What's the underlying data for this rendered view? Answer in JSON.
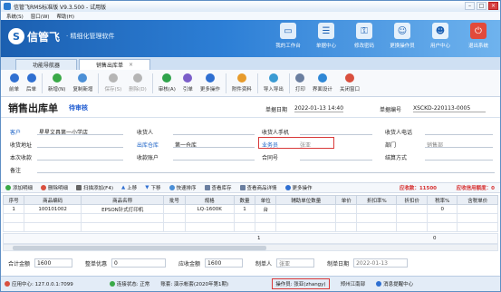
{
  "window": {
    "title": "信管飞RMS标准版 V9.3.500 - 试用版"
  },
  "menu": [
    "系统(S)",
    "窗口(W)",
    "帮助(H)"
  ],
  "banner": {
    "brand": "信管飞",
    "slogan": "· 精细化管理软件"
  },
  "top_tools": [
    {
      "label": "我的工作台",
      "icon": "monitor-icon"
    },
    {
      "label": "单据中心",
      "icon": "document-center-icon"
    },
    {
      "label": "修改密码",
      "icon": "key-icon"
    },
    {
      "label": "更换操作员",
      "icon": "users-icon"
    },
    {
      "label": "用户中心",
      "icon": "user-icon"
    },
    {
      "label": "退出系统",
      "icon": "power-icon"
    }
  ],
  "tabs": [
    {
      "label": "功能导航器"
    },
    {
      "label": "销售出库单",
      "close": "×"
    }
  ],
  "toolbar": [
    {
      "label": "前单",
      "color": "#2f6fd1",
      "disabled": false
    },
    {
      "label": "后单",
      "color": "#2f6fd1",
      "disabled": false
    },
    {
      "label": "新增(N)",
      "color": "#3aa948",
      "disabled": false
    },
    {
      "label": "复制新增",
      "color": "#4b8fd6",
      "disabled": false
    },
    {
      "label": "保存(S)",
      "color": "#b5b5b5",
      "disabled": true
    },
    {
      "label": "删除(D)",
      "color": "#b5b5b5",
      "disabled": true
    },
    {
      "label": "审核(A)",
      "color": "#2fa34c",
      "disabled": false
    },
    {
      "label": "引单",
      "color": "#7b5ec9",
      "disabled": false
    },
    {
      "label": "更多操作",
      "color": "#2f6fd1",
      "disabled": false
    },
    {
      "label": "附件资料",
      "color": "#e79b2c",
      "disabled": false
    },
    {
      "label": "导入导出",
      "color": "#3a9bd3",
      "disabled": false
    },
    {
      "label": "打印",
      "color": "#6b7fa0",
      "disabled": false
    },
    {
      "label": "界面设计",
      "color": "#2f88d6",
      "disabled": false
    },
    {
      "label": "关闭窗口",
      "color": "#d9503f",
      "disabled": false
    }
  ],
  "form": {
    "title": "销售出库单",
    "status": "待审核",
    "date_label": "单据日期",
    "date_value": "2022-01-13 14:40",
    "no_label": "单据编号",
    "no_value": "XSCKD-220113-0005",
    "fields": {
      "customer_label": "客户",
      "customer_value": "星星文具第一小学店",
      "receiver_label": "收货人",
      "receiver_phone_label": "收货人手机",
      "receiver_tel_label": "收货人电话",
      "address_label": "收货地址",
      "warehouse_label": "出库仓库",
      "warehouse_value": "第一仓库",
      "salesman_label": "业务员",
      "salesman_value": "张亚",
      "dept_label": "部门",
      "dept_value": "销售部",
      "received_label": "本次收款",
      "account_label": "收款账户",
      "contract_label": "合同号",
      "settle_label": "结算方式",
      "remark_label": "备注"
    }
  },
  "mid_actions": [
    "添加明细",
    "删除明细",
    "扫描添加(F4)",
    "上移",
    "下移",
    "快速排序",
    "查看库存",
    "查看商品详情",
    "更多操作"
  ],
  "receivable": "应收款：11500",
  "credit": "应收信用额度：0",
  "table": {
    "headers": [
      "序号",
      "商品编码",
      "商品名称",
      "批号",
      "规格",
      "数量",
      "单位",
      "辅助单位数量",
      "单价",
      "折扣率%",
      "折扣价",
      "税率%",
      "含税单价"
    ],
    "rows": [
      [
        "1",
        "100101002",
        "EPSON针式打印机",
        "",
        "LQ-1600K",
        "1",
        "台",
        "",
        "",
        "",
        "",
        "0",
        ""
      ]
    ],
    "footer_qty": "1",
    "footer_right": "0"
  },
  "totals": {
    "sum_label": "合计金额",
    "sum_value": "1600",
    "discount_label": "整单优惠",
    "discount_value": "0",
    "receivable_label": "应收金额",
    "receivable_value": "1600",
    "maker_label": "制单人",
    "maker_value": "张亚",
    "made_date_label": "制单日期",
    "made_date_value": "2022-01-13"
  },
  "statusbar": {
    "app_center": "应用中心: 127.0.0.1:7099",
    "conn": "连接状态: 正常",
    "account": "账套: 演示帐套(2020年第1期)",
    "operator": "操作员: 张亚(zhangy)",
    "branch": "郑州江南部",
    "msg": "消息提醒中心"
  }
}
